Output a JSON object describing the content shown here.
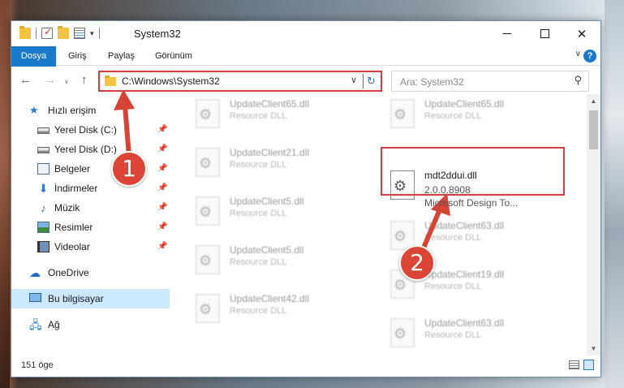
{
  "window": {
    "title": "System32",
    "minimize_icon": "minimize-icon",
    "maximize_icon": "maximize-icon",
    "close_icon": "close-icon"
  },
  "ribbon": {
    "tabs": [
      {
        "label": "Dosya",
        "active": true
      },
      {
        "label": "Giriş"
      },
      {
        "label": "Paylaş"
      },
      {
        "label": "Görünüm"
      }
    ],
    "help_label": "?"
  },
  "address_bar": {
    "path": "C:\\Windows\\System32"
  },
  "search": {
    "placeholder": "Ara: System32"
  },
  "sidebar": {
    "items": [
      {
        "label": "Hızlı erişim",
        "icon": "quick-access-star-icon"
      },
      {
        "label": "Yerel Disk (C:)",
        "icon": "drive-icon",
        "pinned": true
      },
      {
        "label": "Yerel Disk (D:)",
        "icon": "drive-icon",
        "pinned": true
      },
      {
        "label": "Belgeler",
        "icon": "documents-icon",
        "pinned": true
      },
      {
        "label": "İndirmeler",
        "icon": "downloads-icon",
        "pinned": true
      },
      {
        "label": "Müzik",
        "icon": "music-icon",
        "pinned": true
      },
      {
        "label": "Resimler",
        "icon": "pictures-icon",
        "pinned": true
      },
      {
        "label": "Videolar",
        "icon": "videos-icon",
        "pinned": true
      },
      {
        "label": "OneDrive",
        "icon": "onedrive-cloud-icon"
      },
      {
        "label": "Bu bilgisayar",
        "icon": "this-pc-icon",
        "selected": true
      },
      {
        "label": "Ağ",
        "icon": "network-icon"
      }
    ]
  },
  "files": {
    "col1": [
      {
        "name": "UpdateClient65.dll",
        "desc": "Resource DLL"
      },
      {
        "name": "UpdateClient21.dll",
        "desc": "Resource DLL"
      },
      {
        "name": "UpdateClient5.dll",
        "desc": "Resource DLL"
      },
      {
        "name": "UpdateClient5.dll",
        "desc": "Resource DLL"
      },
      {
        "name": "UpdateClient42.dll",
        "desc": "Resource DLL"
      }
    ],
    "col2": [
      {
        "name": "UpdateClient65.dll",
        "desc": "Resource DLL"
      },
      {
        "name": "mdt2ddui.dll",
        "version": "2.0.0.8908",
        "company": "Microsoft Design To...",
        "highlighted": true
      },
      {
        "name": "UpdateClient63.dll",
        "desc": "Resource DLL"
      },
      {
        "name": "UpdateClient19.dll",
        "desc": "Resource DLL"
      },
      {
        "name": "UpdateClient63.dll",
        "desc": "Resource DLL"
      }
    ]
  },
  "status_bar": {
    "item_count": "151 öge"
  },
  "callouts": [
    {
      "number": "1"
    },
    {
      "number": "2"
    }
  ],
  "colors": {
    "accent": "#1979ca",
    "annotation_red": "#d23f3f",
    "selection": "#cce8ff"
  }
}
